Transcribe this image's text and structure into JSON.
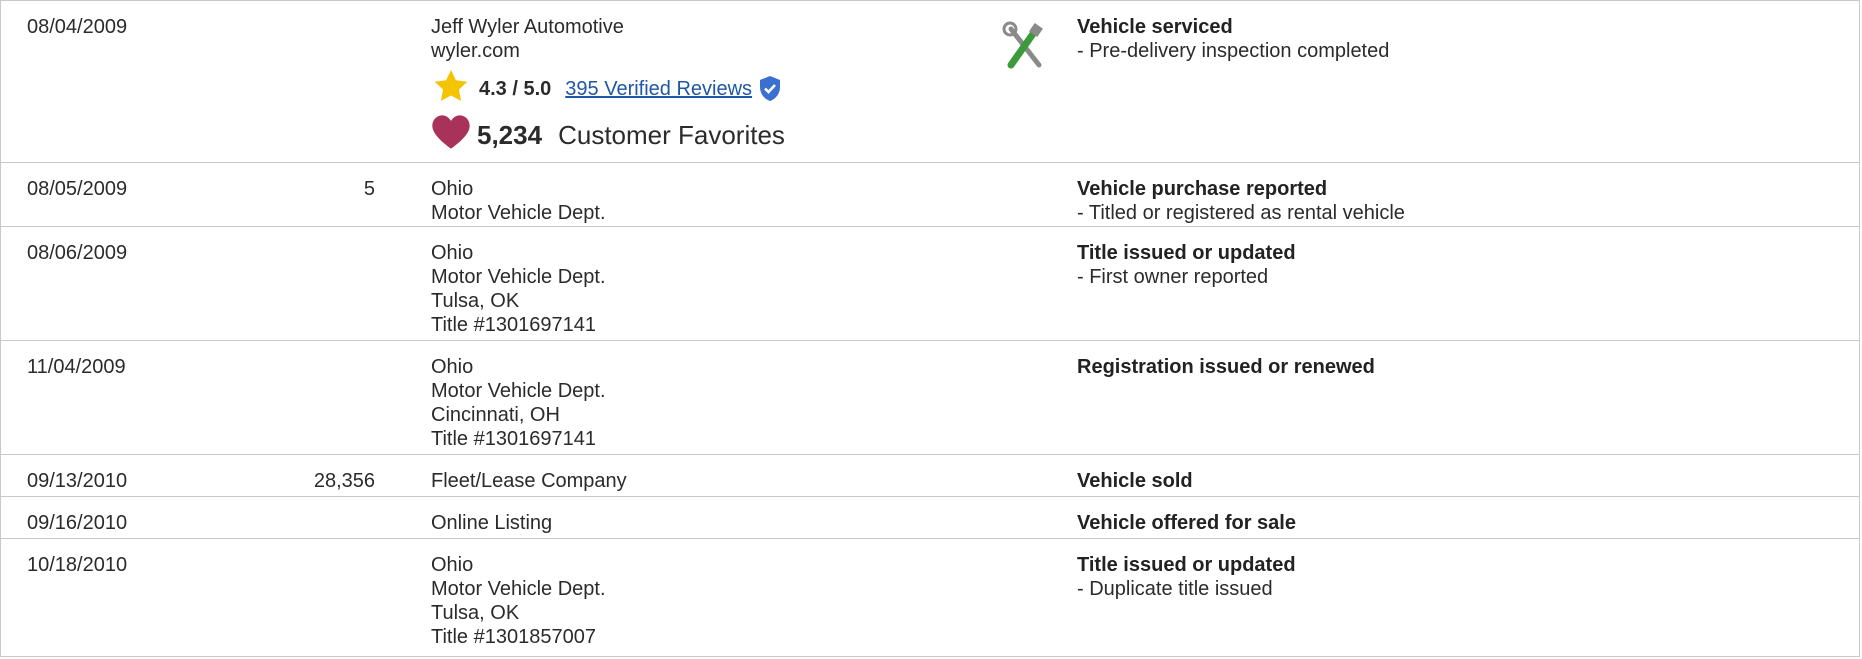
{
  "rows": [
    {
      "date": "08/04/2009",
      "odometer": "",
      "source_lines": [
        "Jeff Wyler Automotive",
        "wyler.com"
      ],
      "rating": {
        "score": "4.3 / 5.0",
        "reviews_link": "395 Verified Reviews"
      },
      "favorites": {
        "count": "5,234",
        "label": "Customer Favorites"
      },
      "icon": "tools-icon",
      "detail_title": "Vehicle serviced",
      "detail_lines": [
        "- Pre-delivery inspection completed"
      ]
    },
    {
      "date": "08/05/2009",
      "odometer": "5",
      "source_lines": [
        "Ohio",
        "Motor Vehicle Dept."
      ],
      "detail_title": "Vehicle purchase reported",
      "detail_lines": [
        "- Titled or registered as rental vehicle"
      ]
    },
    {
      "date": "08/06/2009",
      "odometer": "",
      "source_lines": [
        "Ohio",
        "Motor Vehicle Dept.",
        "Tulsa, OK",
        "Title #1301697141"
      ],
      "detail_title": "Title issued or updated",
      "detail_lines": [
        "- First owner reported"
      ]
    },
    {
      "date": "11/04/2009",
      "odometer": "",
      "source_lines": [
        "Ohio",
        "Motor Vehicle Dept.",
        "Cincinnati, OH",
        "Title #1301697141"
      ],
      "detail_title": "Registration issued or renewed",
      "detail_lines": []
    },
    {
      "date": "09/13/2010",
      "odometer": "28,356",
      "source_lines": [
        "Fleet/Lease Company"
      ],
      "detail_title": "Vehicle sold",
      "detail_lines": []
    },
    {
      "date": "09/16/2010",
      "odometer": "",
      "source_lines": [
        "Online Listing"
      ],
      "detail_title": "Vehicle offered for sale",
      "detail_lines": []
    },
    {
      "date": "10/18/2010",
      "odometer": "",
      "source_lines": [
        "Ohio",
        "Motor Vehicle Dept.",
        "Tulsa, OK",
        "Title #1301857007"
      ],
      "detail_title": "Title issued or updated",
      "detail_lines": [
        "- Duplicate title issued"
      ]
    }
  ],
  "colors": {
    "border": "#c8c8c8",
    "link": "#1f57a8",
    "star": "#f5c400",
    "heart": "#a8325a",
    "verified": "#3b6fd0"
  }
}
